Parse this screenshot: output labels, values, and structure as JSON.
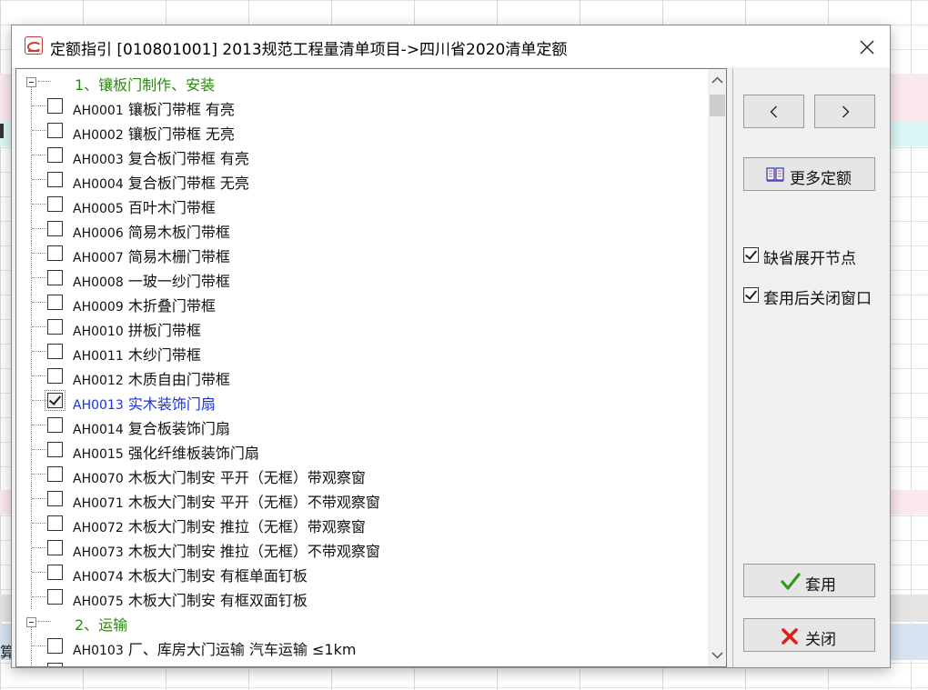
{
  "background": {
    "partial_label": "算",
    "band_colors": {
      "pink": "#fbe9ee",
      "cyan": "#dcf7f7",
      "gray": "#e4e4e4",
      "blue_bar": "#d6e4f2"
    }
  },
  "dialog": {
    "title": "定额指引 [010801001] 2013规范工程量清单项目->四川省2020清单定额",
    "icon": "app-logo-icon",
    "close_icon": "close-icon"
  },
  "tree": {
    "groups": [
      {
        "label": "1、镶板门制作、安装",
        "items": [
          {
            "code": "AH0001",
            "name": "镶板门带框 有亮",
            "checked": false
          },
          {
            "code": "AH0002",
            "name": "镶板门带框 无亮",
            "checked": false
          },
          {
            "code": "AH0003",
            "name": "复合板门带框 有亮",
            "checked": false
          },
          {
            "code": "AH0004",
            "name": "复合板门带框 无亮",
            "checked": false
          },
          {
            "code": "AH0005",
            "name": "百叶木门带框",
            "checked": false
          },
          {
            "code": "AH0006",
            "name": "简易木板门带框",
            "checked": false
          },
          {
            "code": "AH0007",
            "name": "简易木栅门带框",
            "checked": false
          },
          {
            "code": "AH0008",
            "name": "一玻一纱门带框",
            "checked": false
          },
          {
            "code": "AH0009",
            "name": "木折叠门带框",
            "checked": false
          },
          {
            "code": "AH0010",
            "name": "拼板门带框",
            "checked": false
          },
          {
            "code": "AH0011",
            "name": "木纱门带框",
            "checked": false
          },
          {
            "code": "AH0012",
            "name": "木质自由门带框",
            "checked": false
          },
          {
            "code": "AH0013",
            "name": "实木装饰门扇",
            "checked": true,
            "selected": true
          },
          {
            "code": "AH0014",
            "name": "复合板装饰门扇",
            "checked": false
          },
          {
            "code": "AH0015",
            "name": "强化纤维板装饰门扇",
            "checked": false
          },
          {
            "code": "AH0070",
            "name": "木板大门制安 平开（无框）带观察窗",
            "checked": false
          },
          {
            "code": "AH0071",
            "name": "木板大门制安 平开（无框）不带观察窗",
            "checked": false
          },
          {
            "code": "AH0072",
            "name": "木板大门制安 推拉（无框）带观察窗",
            "checked": false
          },
          {
            "code": "AH0073",
            "name": "木板大门制安 推拉（无框）不带观察窗",
            "checked": false
          },
          {
            "code": "AH0074",
            "name": "木板大门制安 有框单面钉板",
            "checked": false
          },
          {
            "code": "AH0075",
            "name": "木板大门制安 有框双面钉板",
            "checked": false
          }
        ]
      },
      {
        "label": "2、运输",
        "items": [
          {
            "code": "AH0103",
            "name": "厂、库房大门运输 汽车运输 ≤1km",
            "checked": false
          },
          {
            "code": "",
            "name": "",
            "checked": false
          }
        ]
      }
    ],
    "colors": {
      "group_text": "#2a8a0e",
      "selected_text": "#1a33d6"
    }
  },
  "side": {
    "prev_icon": "chevron-left-icon",
    "next_icon": "chevron-right-icon",
    "more_quota": {
      "label": "更多定额",
      "icon": "book-icon"
    },
    "options": [
      {
        "label": "缺省展开节点",
        "checked": true
      },
      {
        "label": "套用后关闭窗口",
        "checked": true
      }
    ],
    "apply": {
      "label": "套用",
      "icon": "green-check-icon"
    },
    "close": {
      "label": "关闭",
      "icon": "red-x-icon"
    }
  }
}
